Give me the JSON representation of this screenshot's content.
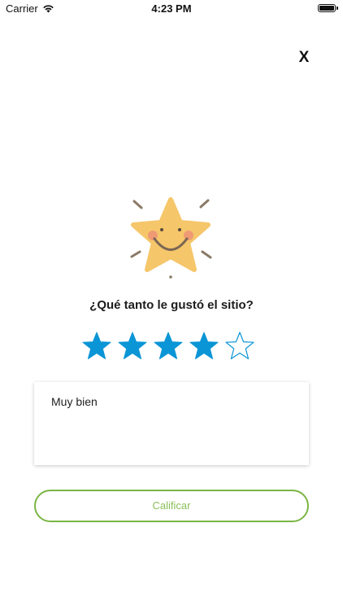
{
  "status_bar": {
    "carrier": "Carrier",
    "time": "4:23 PM",
    "wifi_icon": "wifi-icon",
    "battery_icon": "battery-icon",
    "battery_level": 1.0
  },
  "close_label": "X",
  "mascot_icon": "smiling-star-icon",
  "question": "¿Qué tanto le gustó el sitio?",
  "rating": {
    "value": 4,
    "max": 5,
    "filled_color": "#0a95d6",
    "empty_color": "#0a95d6"
  },
  "comment_value": "Muy bien",
  "submit_label": "Calificar",
  "colors": {
    "accent_green": "#7bb543",
    "mascot_yellow": "#f5c66a",
    "rating_blue": "#0a95d6"
  }
}
